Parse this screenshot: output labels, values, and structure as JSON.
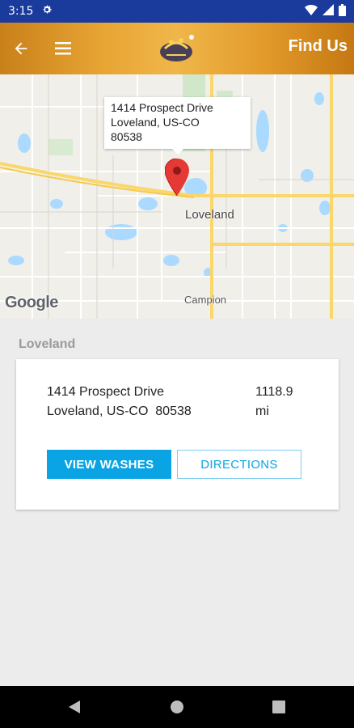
{
  "status_bar": {
    "time": "3:15",
    "settings_icon": "gear-icon",
    "wifi_icon": "wifi-icon",
    "signal_icon": "cell-signal-icon",
    "battery_icon": "battery-icon"
  },
  "app_bar": {
    "title": "Find Us",
    "back_icon": "arrow-left-icon",
    "menu_icon": "hamburger-menu-icon",
    "logo": "brand-logo"
  },
  "map": {
    "info_window": {
      "line1": "1414 Prospect Drive",
      "line2": "Loveland, US-CO",
      "line3": "80538"
    },
    "city_label": "Loveland",
    "town_label": "Campion",
    "attribution": "Google",
    "colors": {
      "land": "#f1efe9",
      "water": "#aadaff",
      "park": "#c8e6c0",
      "highway": "#f9d76b",
      "road": "#ffffff"
    }
  },
  "location": {
    "section_title": "Loveland",
    "address_line1": "1414 Prospect Drive",
    "address_line2": "Loveland, US-CO  80538",
    "distance_value": "1118.9",
    "distance_unit": "mi",
    "view_washes_label": "VIEW WASHES",
    "directions_label": "DIRECTIONS"
  },
  "colors": {
    "status_bar": "#1a3a9c",
    "accent": "#0aa4e4",
    "app_bar": "#e8a634"
  }
}
